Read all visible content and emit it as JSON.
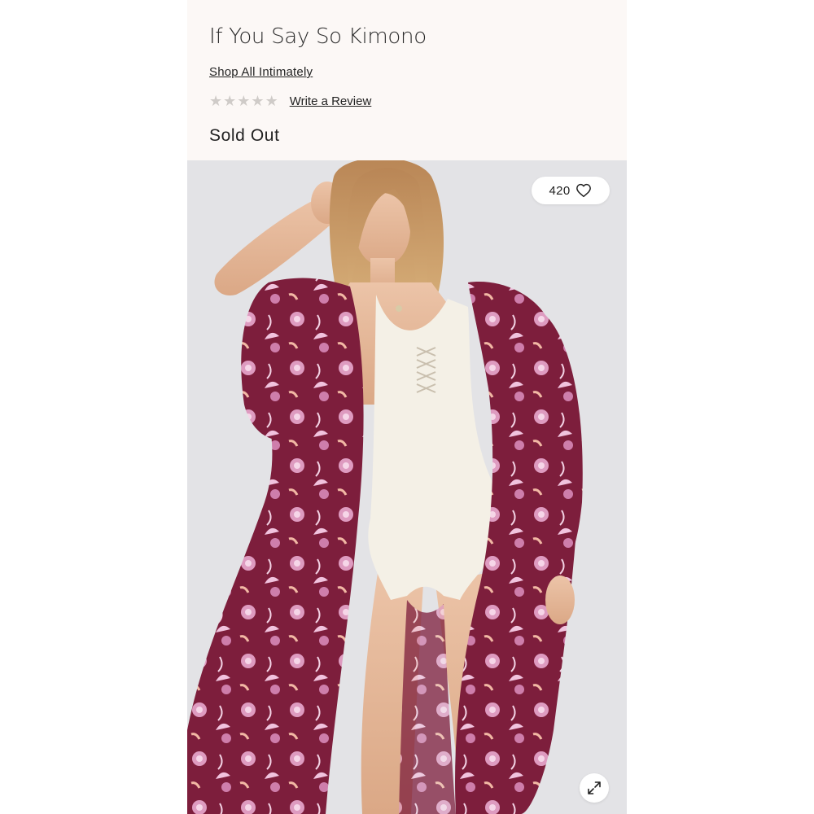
{
  "product": {
    "title": "If You Say So Kimono",
    "brand_link": "Shop All Intimately",
    "rating": {
      "stars_filled": 0,
      "stars_total": 5,
      "review_link": "Write a Review"
    },
    "availability": "Sold Out"
  },
  "gallery": {
    "favorite_count": "420",
    "favorite_icon": "heart-outline-icon",
    "expand_icon": "expand-arrows-icon",
    "image_alt": "Model wearing a burgundy floral kimono over a white lace-up bodysuit"
  },
  "colors": {
    "page_background": "#fcf8f6",
    "photo_background": "#e3e3e6",
    "kimono_base": "#7d1e3c",
    "kimono_print": "#e9a9cf",
    "bodysuit": "#f4f0e6",
    "text": "#222222",
    "star_empty": "#cfcbc8"
  }
}
